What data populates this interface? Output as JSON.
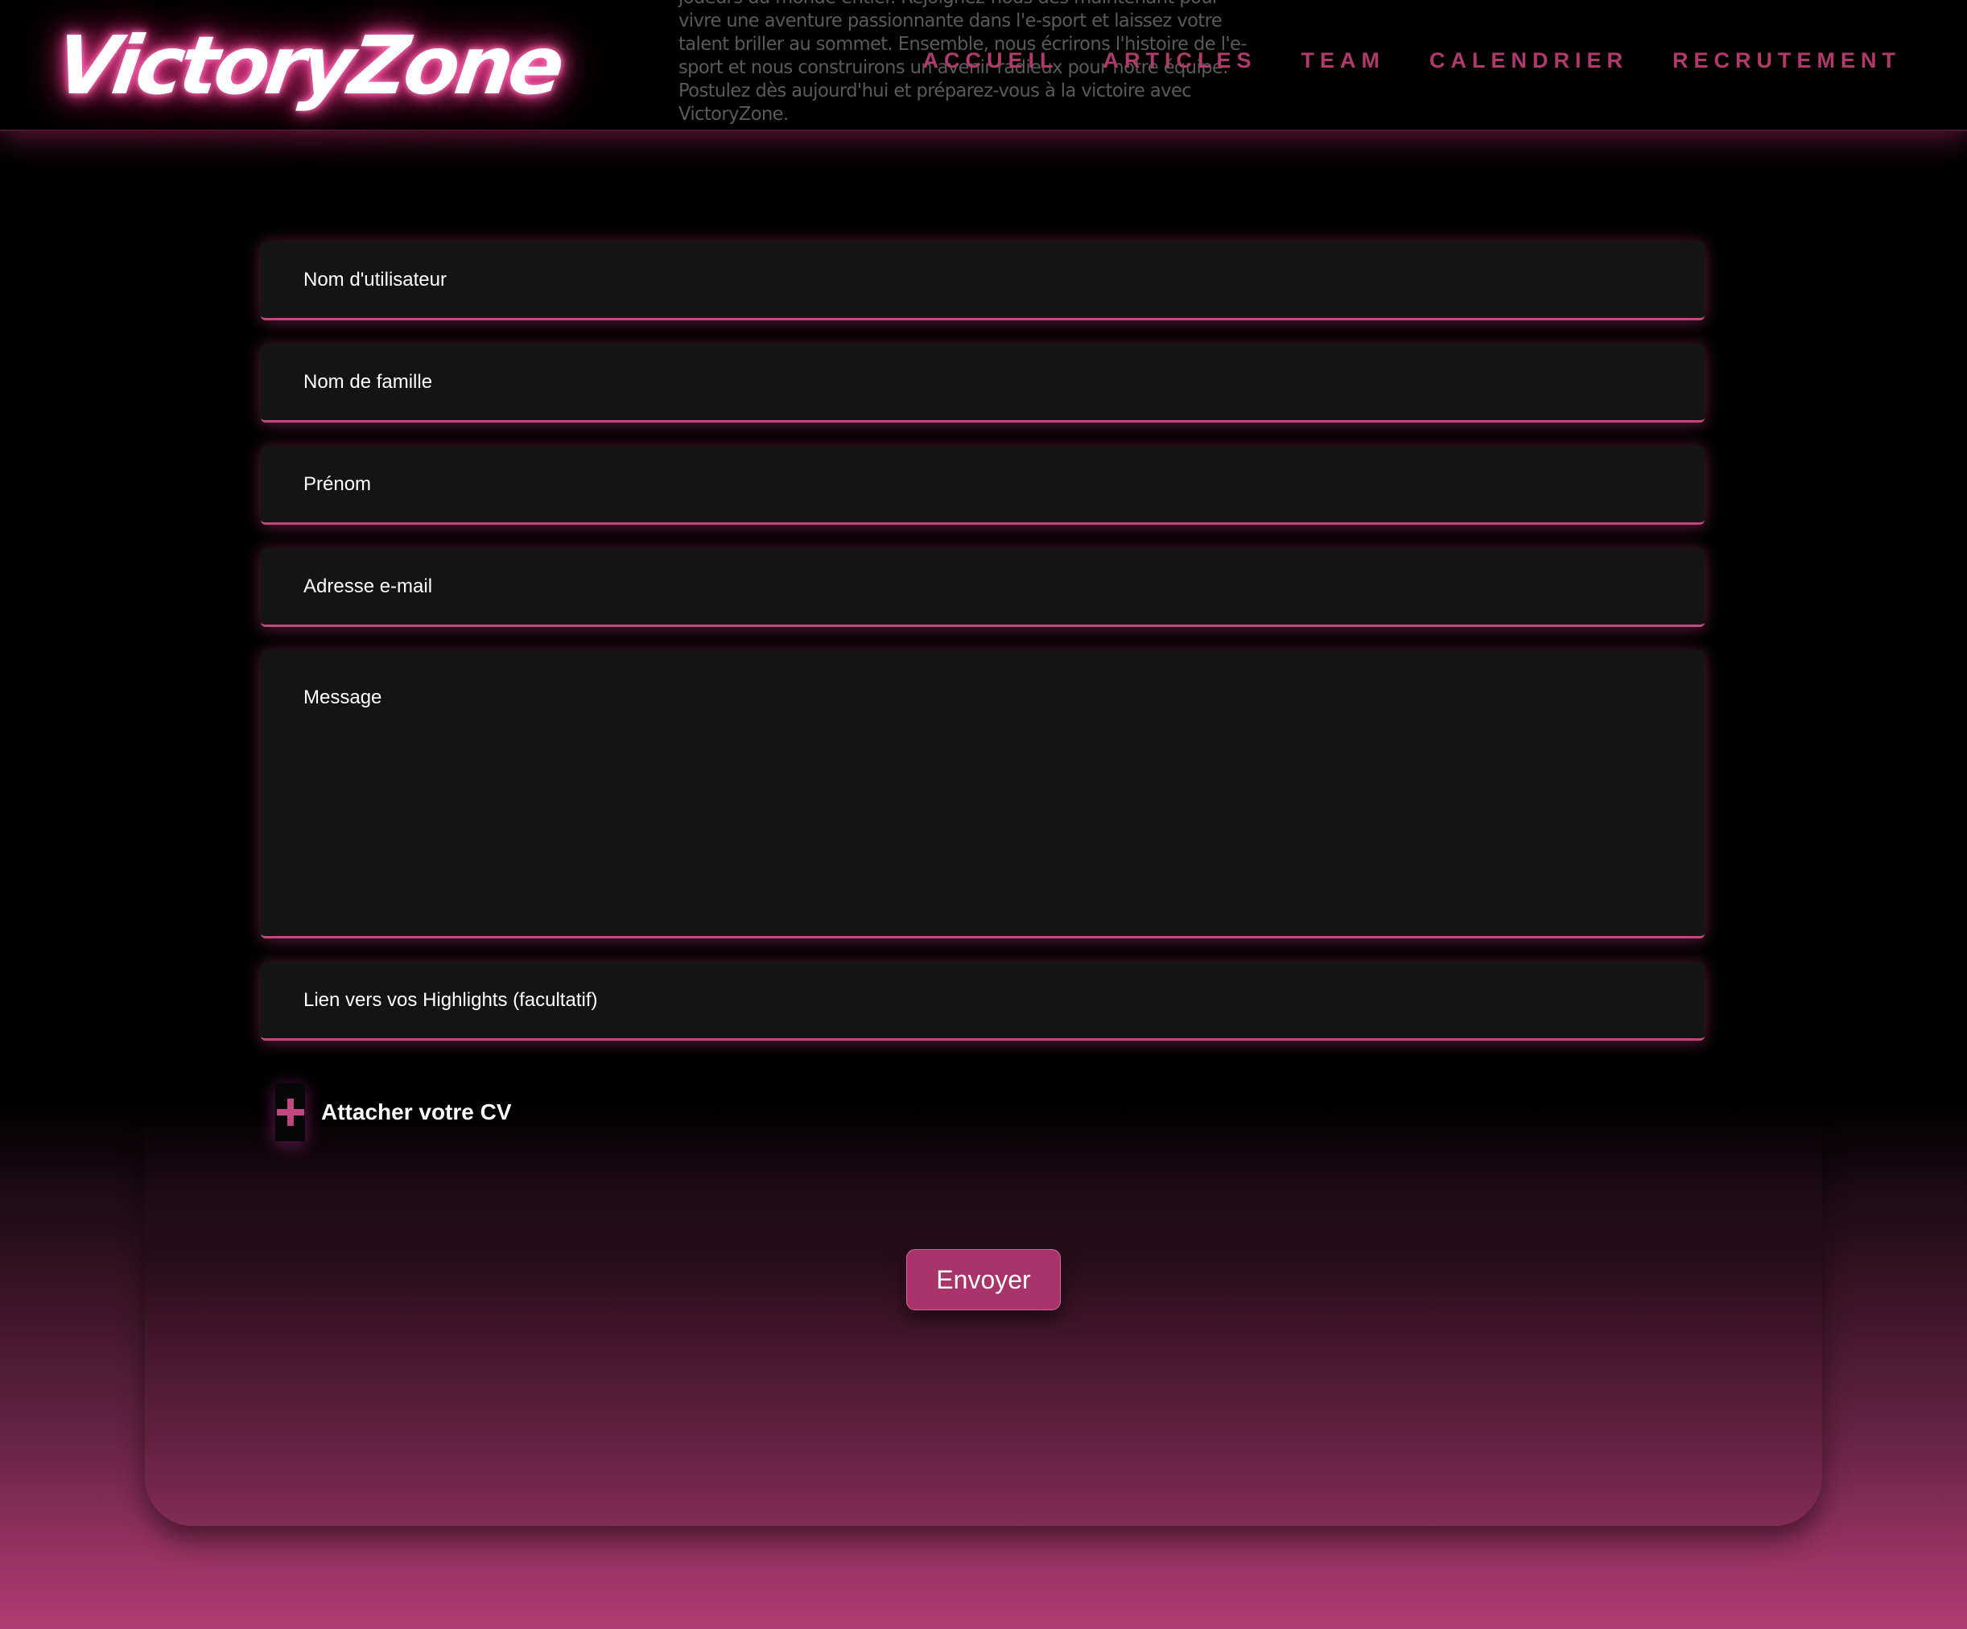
{
  "header": {
    "logo_text": "VictoryZone",
    "background_text": "joueurs du monde entier. Rejoignez-nous dès maintenant pour vivre une aventure passionnante dans l'e-sport et laissez votre talent briller au sommet. Ensemble, nous écrirons l'histoire de l'e-sport et nous construirons un avenir radieux pour notre équipe. Postulez dès aujourd'hui et préparez-vous à la victoire avec VictoryZone.",
    "nav": [
      {
        "label": "ACCUEIL"
      },
      {
        "label": "ARTICLES"
      },
      {
        "label": "TEAM"
      },
      {
        "label": "CALENDRIER"
      },
      {
        "label": "RECRUTEMENT"
      }
    ]
  },
  "form": {
    "username": {
      "placeholder": "Nom d'utilisateur",
      "value": ""
    },
    "lastname": {
      "placeholder": "Nom de famille",
      "value": ""
    },
    "firstname": {
      "placeholder": "Prénom",
      "value": ""
    },
    "email": {
      "placeholder": "Adresse e-mail",
      "value": ""
    },
    "message": {
      "placeholder": "Message",
      "value": ""
    },
    "highlights": {
      "placeholder": "Lien vers vos Highlights (facultatif)",
      "value": ""
    },
    "attach_cv_label": "Attacher votre CV",
    "attach_icon": "plus-icon",
    "submit_label": "Envoyer"
  },
  "colors": {
    "accent": "#b03a6c",
    "field_background": "#141414",
    "page_background": "#000000",
    "gradient_bottom": "#b03d71"
  }
}
